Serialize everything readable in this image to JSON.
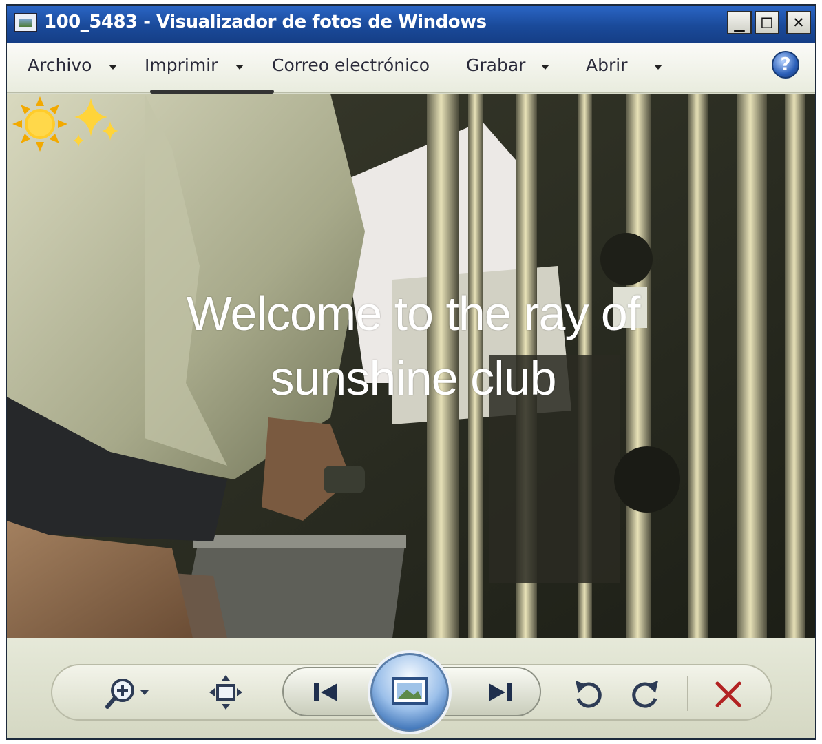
{
  "window": {
    "title": "100_5483 - Visualizador de fotos de Windows",
    "minimize_label": "_",
    "maximize_label": "□",
    "close_label": "✕"
  },
  "menu": {
    "items": [
      {
        "label": "Archivo",
        "has_dropdown": true
      },
      {
        "label": "Imprimir",
        "has_dropdown": true
      },
      {
        "label": "Correo electrónico",
        "has_dropdown": false
      },
      {
        "label": "Grabar",
        "has_dropdown": true
      },
      {
        "label": "Abrir",
        "has_dropdown": true
      }
    ],
    "help_label": "?"
  },
  "photo": {
    "caption_line1": "Welcome to the ray of",
    "caption_line2": "sunshine club",
    "caption_emoji": "☀️✨"
  },
  "controls": {
    "icons": [
      "zoom-icon",
      "actual-size-icon",
      "previous-icon",
      "slideshow-icon",
      "next-icon",
      "rotate-counterclockwise-icon",
      "rotate-clockwise-icon",
      "delete-icon"
    ]
  },
  "colors": {
    "titlebar": "#1a4a9a",
    "delete_red": "#b22222",
    "accent_blue": "#386fb5"
  }
}
